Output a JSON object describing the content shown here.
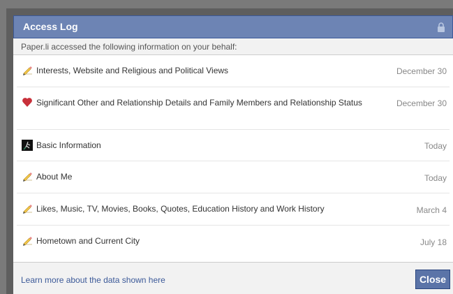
{
  "dialog": {
    "title": "Access Log",
    "subtitle": "Paper.li accessed the following information on your behalf:",
    "title_bar_color": "#6d84b4"
  },
  "rows": [
    {
      "icon": "pencil-icon",
      "label": "Interests, Website and Religious and Political Views",
      "date": "December 30"
    },
    {
      "icon": "heart-icon",
      "label": "Significant Other and Relationship Details and Family Members and Relationship Status",
      "date": "December 30"
    },
    {
      "icon": "profile-photo-icon",
      "label": "Basic Information",
      "date": "Today"
    },
    {
      "icon": "pencil-icon",
      "label": "About Me",
      "date": "Today"
    },
    {
      "icon": "pencil-icon",
      "label": "Likes, Music, TV, Movies, Books, Quotes, Education History and Work History",
      "date": "March 4"
    },
    {
      "icon": "pencil-icon",
      "label": "Hometown and Current City",
      "date": "July 18"
    }
  ],
  "footer": {
    "learn_more": "Learn more about the data shown here",
    "close_label": "Close"
  },
  "colors": {
    "link": "#3b5998",
    "button": "#5b74a8",
    "heart": "#c8303a"
  }
}
